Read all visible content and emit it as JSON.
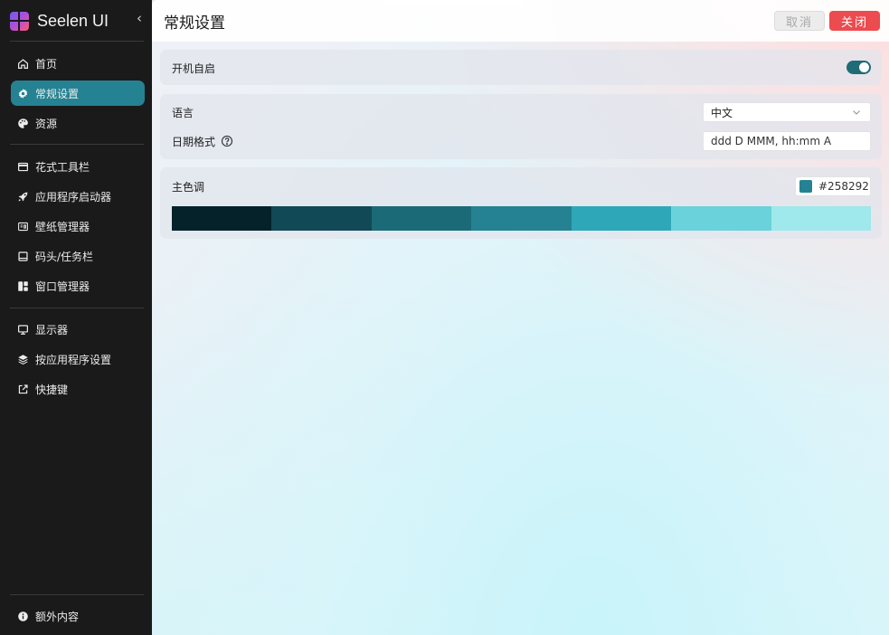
{
  "app": {
    "title": "Seelen UI",
    "collapse_glyph": "‹"
  },
  "sidebar": {
    "group1": [
      {
        "label": "首页",
        "icon": "home-icon",
        "active": false
      },
      {
        "label": "常规设置",
        "icon": "gear-icon",
        "active": true
      },
      {
        "label": "资源",
        "icon": "palette-icon",
        "active": false
      }
    ],
    "group2": [
      {
        "label": "花式工具栏",
        "icon": "toolbar-icon"
      },
      {
        "label": "应用程序启动器",
        "icon": "rocket-icon"
      },
      {
        "label": "壁纸管理器",
        "icon": "wallpaper-icon"
      },
      {
        "label": "码头/任务栏",
        "icon": "dock-icon"
      },
      {
        "label": "窗口管理器",
        "icon": "window-manager-icon"
      }
    ],
    "group3": [
      {
        "label": "显示器",
        "icon": "monitor-icon"
      },
      {
        "label": "按应用程序设置",
        "icon": "layers-icon"
      },
      {
        "label": "快捷键",
        "icon": "external-link-icon"
      }
    ],
    "footer": {
      "label": "额外内容",
      "icon": "info-icon"
    }
  },
  "header": {
    "title": "常规设置",
    "cancel_label": "取消",
    "close_label": "关闭"
  },
  "settings": {
    "autostart": {
      "label": "开机自启",
      "enabled": true
    },
    "language": {
      "label": "语言",
      "value": "中文"
    },
    "date_format": {
      "label": "日期格式",
      "value": "ddd D MMM, hh:mm A"
    },
    "accent": {
      "label": "主色调",
      "value": "#258292",
      "palette": [
        "#05222b",
        "#124956",
        "#1b6a78",
        "#258292",
        "#2ea8b8",
        "#6ad2db",
        "#9fe8eb"
      ]
    }
  },
  "colors": {
    "sidebar_bg": "#1a1a1a",
    "active_item": "#258292",
    "close_button": "#ec4b4f",
    "toggle_on": "#1e6c76"
  }
}
